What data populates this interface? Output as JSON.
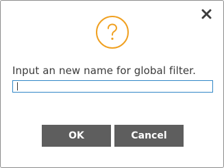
{
  "dialog": {
    "prompt": "Input an new name for global filter.",
    "input_value": "",
    "icon": "question-circle-icon",
    "close_icon": "close-icon",
    "accent_color": "#f0a020",
    "button_color": "#5e5e5e"
  },
  "buttons": {
    "ok_label": "OK",
    "cancel_label": "Cancel"
  }
}
